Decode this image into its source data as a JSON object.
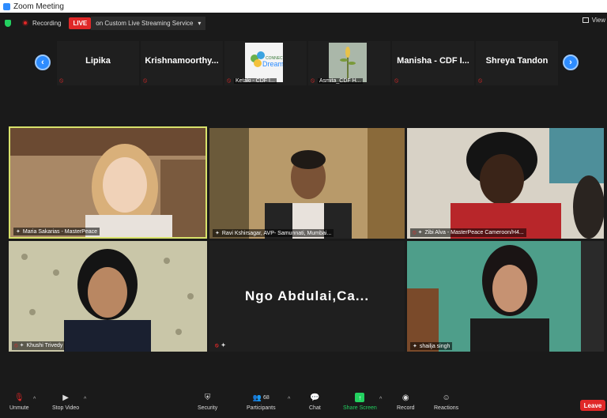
{
  "window": {
    "title": "Zoom Meeting"
  },
  "topbar": {
    "recording_label": "Recording",
    "live_badge": "LIVE",
    "stream_service": "on Custom Live Streaming Service",
    "view_label": "View"
  },
  "strip": {
    "thumbnails": [
      {
        "name": "Lipika"
      },
      {
        "name": "Krishnamoorthy..."
      },
      {
        "caption": "Ketaki - CDF I..."
      },
      {
        "caption": "Asmita_CDF H..."
      },
      {
        "name": "Manisha - CDF I..."
      },
      {
        "name": "Shreya Tandon"
      }
    ],
    "logo_text": "CONNECTING DREAMS"
  },
  "gallery": [
    {
      "label": "Maria Sakarias - MasterPeace"
    },
    {
      "label": "Ravi Kshirsagar, AVP- Samunnati, Mumbai..."
    },
    {
      "label": "Zibi Alva - MasterPeace Cameroon/H4..."
    },
    {
      "label": "Khushi Trivedy"
    },
    {
      "name_card": "Ngo Abdulai,Ca..."
    },
    {
      "label": "shailja singh"
    }
  ],
  "toolbar": {
    "unmute": "Unmute",
    "stop_video": "Stop Video",
    "security": "Security",
    "participants": "Participants",
    "participants_count": "68",
    "chat": "Chat",
    "share_screen": "Share Screen",
    "record": "Record",
    "reactions": "Reactions",
    "leave": "Leave"
  },
  "colors": {
    "zoom_blue": "#2d8cff",
    "live_red": "#e02828",
    "active_speaker": "#d8e26b",
    "share_green": "#23d160"
  }
}
